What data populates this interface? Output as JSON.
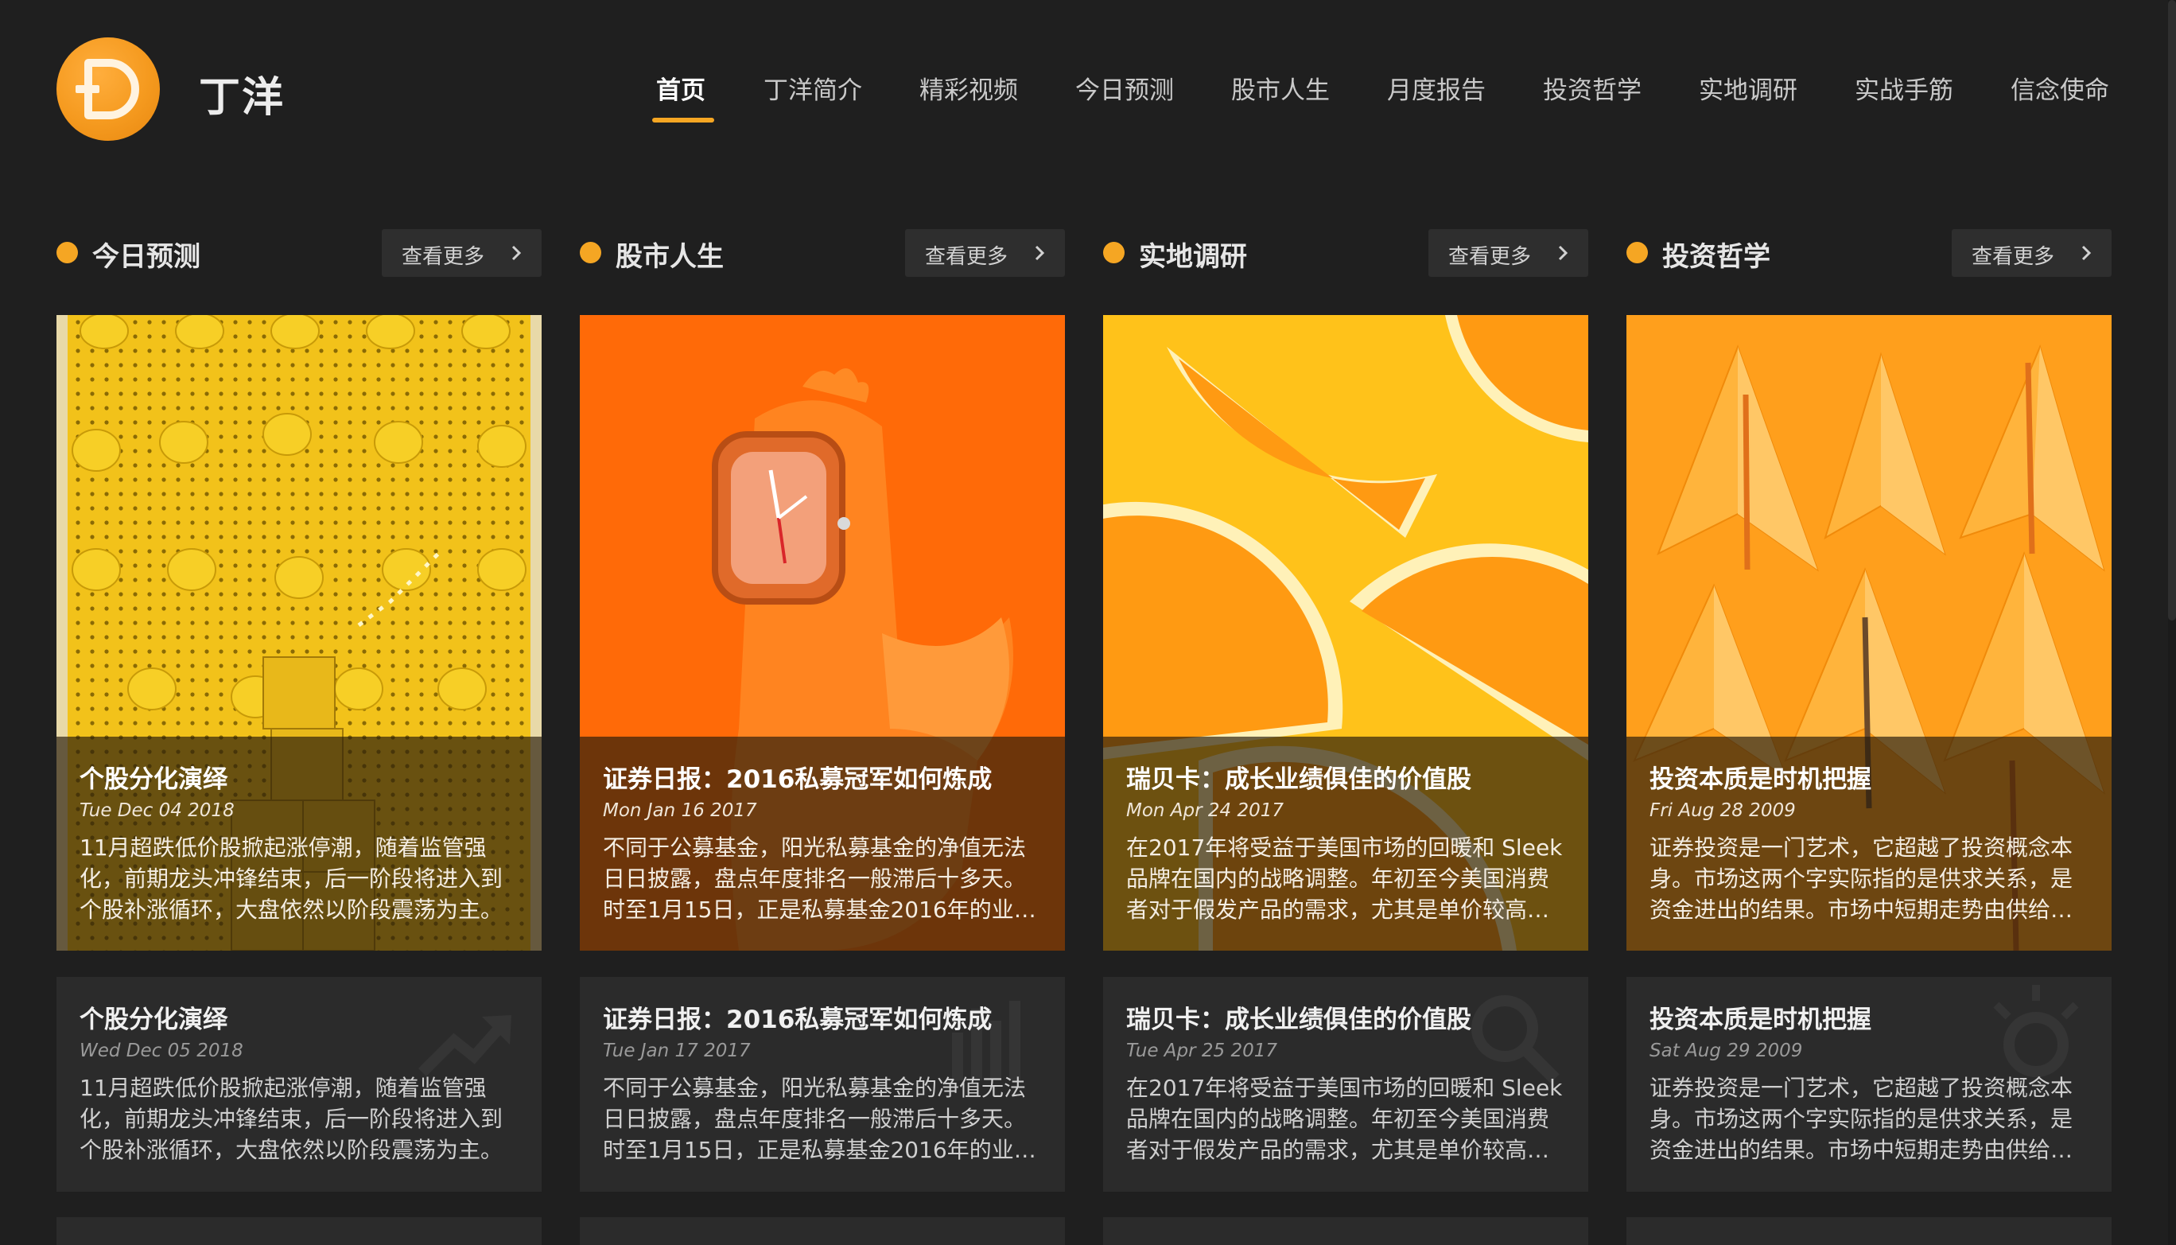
{
  "header": {
    "logo_letter": "D",
    "brand": "丁洋",
    "nav": [
      "首页",
      "丁洋简介",
      "精彩视频",
      "今日预测",
      "股市人生",
      "月度报告",
      "投资哲学",
      "实地调研",
      "实战手筋",
      "信念使命"
    ],
    "active_nav": "首页"
  },
  "colors": {
    "accent": "#f5a623",
    "background": "#1f1f1f",
    "card": "#2b2b2b"
  },
  "sections": [
    {
      "title": "今日预测",
      "more": "查看更多",
      "image": "yellow-mugs-pegboard",
      "featured": {
        "title": "个股分化演绎",
        "date": "Tue Dec 04 2018",
        "text": "11月超跌低价股掀起涨停潮，随着监管强化，前期龙头冲锋结束，后一阶段将进入到个股补涨循环，大盘依然以阶段震荡为主。"
      },
      "second": {
        "title": "个股分化演绎",
        "date": "Wed Dec 05 2018",
        "text": "11月超跌低价股掀起涨停潮，随着监管强化，前期龙头冲锋结束，后一阶段将进入到个股补涨循环，大盘依然以阶段震荡为主。",
        "icon": "trend-up-icon"
      }
    },
    {
      "title": "股市人生",
      "more": "查看更多",
      "image": "orange-rooster-watch",
      "featured": {
        "title": "证券日报：2016私募冠军如何炼成",
        "date": "Mon Jan 16 2017",
        "text": "不同于公募基金，阳光私募基金的净值无法日日披露，盘点年度排名一般滞后十多天。时至1月15日，正是私募基金2016年的业…"
      },
      "second": {
        "title": "证券日报：2016私募冠军如何炼成",
        "date": "Tue Jan 17 2017",
        "text": "不同于公募基金，阳光私募基金的净值无法日日披露，盘点年度排名一般滞后十多天。时至1月15日，正是私募基金2016年的业…",
        "icon": "bar-chart-icon"
      }
    },
    {
      "title": "实地调研",
      "more": "查看更多",
      "image": "orange-slices",
      "featured": {
        "title": "瑞贝卡：成长业绩俱佳的价值股",
        "date": "Mon Apr 24 2017",
        "text": "在2017年将受益于美国市场的回暖和 Sleek 品牌在国内的战略调整。年初至今美国消费者对于假发产品的需求，尤其是单价较高…"
      },
      "second": {
        "title": "瑞贝卡：成长业绩俱佳的价值股",
        "date": "Tue Apr 25 2017",
        "text": "在2017年将受益于美国市场的回暖和 Sleek 品牌在国内的战略调整。年初至今美国消费者对于假发产品的需求，尤其是单价较高…",
        "icon": "search-icon"
      }
    },
    {
      "title": "投资哲学",
      "more": "查看更多",
      "image": "paper-planes",
      "featured": {
        "title": "投资本质是时机把握",
        "date": "Fri Aug 28 2009",
        "text": "证券投资是一门艺术，它超越了投资概念本身。市场这两个字实际指的是供求关系，是资金进出的结果。市场中短期走势由供给…"
      },
      "second": {
        "title": "投资本质是时机把握",
        "date": "Sat Aug 29 2009",
        "text": "证券投资是一门艺术，它超越了投资概念本身。市场这两个字实际指的是供求关系，是资金进出的结果。市场中短期走势由供给…",
        "icon": "lightbulb-icon"
      }
    }
  ]
}
